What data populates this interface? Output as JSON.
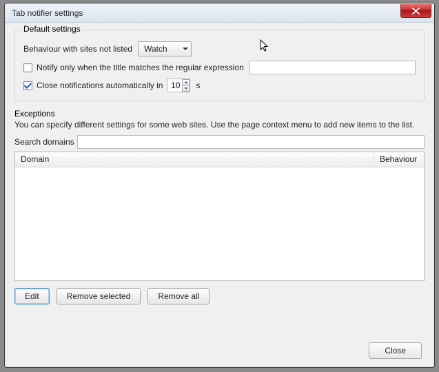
{
  "window": {
    "title": "Tab notifier settings"
  },
  "defaults": {
    "legend": "Default settings",
    "behaviour_label": "Behaviour with sites not listed",
    "behaviour_value": "Watch",
    "notify_regex_label": "Notify only when the title matches the regular expression",
    "notify_regex_checked": false,
    "notify_regex_value": "",
    "close_auto_label": "Close notifications automatically in",
    "close_auto_checked": true,
    "close_auto_value": "10",
    "close_auto_unit": "s"
  },
  "exceptions": {
    "legend": "Exceptions",
    "description": "You can specify different settings for some web sites. Use the page context menu to add new items to the list.",
    "search_label": "Search domains",
    "search_value": "",
    "columns": {
      "domain": "Domain",
      "behaviour": "Behaviour"
    },
    "rows": []
  },
  "buttons": {
    "edit": "Edit",
    "remove_selected": "Remove selected",
    "remove_all": "Remove all",
    "close": "Close"
  }
}
